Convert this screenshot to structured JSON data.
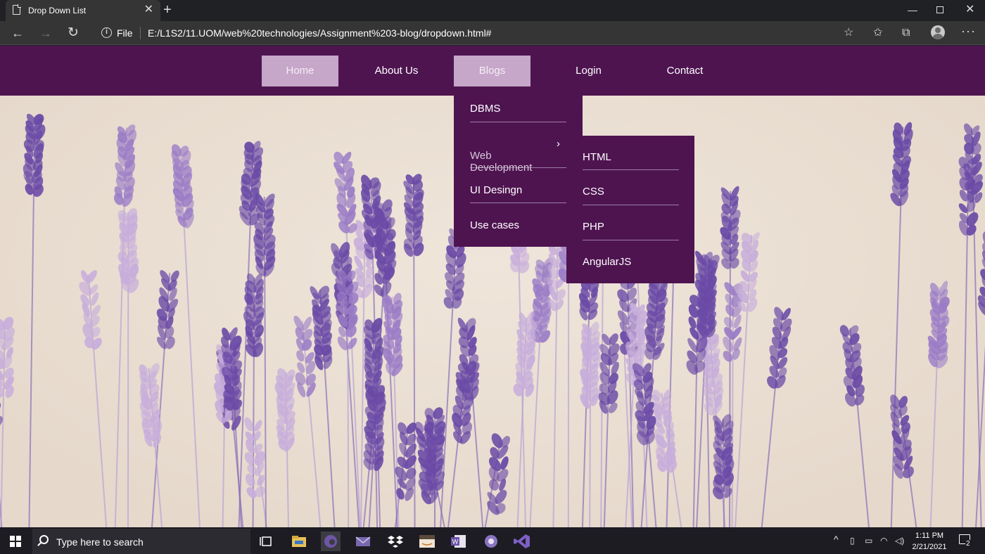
{
  "browser": {
    "tab_title": "Drop Down List",
    "tab_close": "✕",
    "new_tab": "+",
    "file_label": "File",
    "url": "E:/L1S2/11.UOM/web%20technologies/Assignment%203-blog/dropdown.html#"
  },
  "nav": {
    "items": [
      {
        "label": "Home",
        "active": true
      },
      {
        "label": "About Us",
        "active": false
      },
      {
        "label": "Blogs",
        "active": true
      },
      {
        "label": "Login",
        "active": false
      },
      {
        "label": "Contact",
        "active": false
      }
    ]
  },
  "dropdown": {
    "items": [
      {
        "label": "DBMS"
      },
      {
        "label": "Web\nDevelopment",
        "has_submenu": true
      },
      {
        "label": "UI Desingn"
      },
      {
        "label": "Use cases"
      }
    ],
    "arrow": "›"
  },
  "submenu": {
    "items": [
      {
        "label": "HTML"
      },
      {
        "label": "CSS"
      },
      {
        "label": "PHP"
      },
      {
        "label": "AngularJS"
      }
    ]
  },
  "taskbar": {
    "search_placeholder": "Type here to search",
    "time": "1:11 PM",
    "date": "2/21/2021",
    "notification_count": "2",
    "app_icons": [
      "task-view-icon",
      "file-explorer-icon",
      "edge-icon",
      "mail-icon",
      "dropbox-icon",
      "amazon-icon",
      "word-icon",
      "chrome-icon",
      "visual-studio-icon"
    ]
  },
  "colors": {
    "nav_bg": "#4e1450",
    "nav_active": "#c6a6c9",
    "page_bg": "#ece1d6",
    "lavender_light": "#c7aedb",
    "lavender_dark": "#6a4aa6"
  }
}
